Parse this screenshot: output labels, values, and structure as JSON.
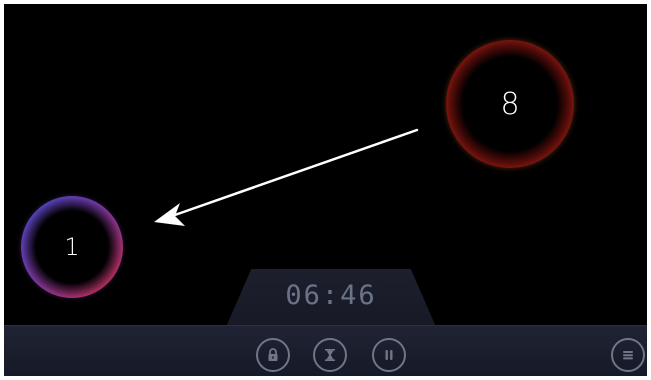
{
  "game": {
    "balls": [
      {
        "label": "8",
        "color": "orange-red"
      },
      {
        "label": "1",
        "color": "blue-purple-red"
      }
    ],
    "timer": "06:46",
    "controls": [
      {
        "icon": "lock-icon"
      },
      {
        "icon": "hourglass-icon"
      },
      {
        "icon": "pause-icon"
      },
      {
        "icon": "menu-icon"
      }
    ]
  },
  "colors": {
    "background": "#000000",
    "bar": "#1b1e2c",
    "control_stroke": "#6e7688",
    "timer_text": "#6a7388",
    "arrow": "#ffffff"
  }
}
